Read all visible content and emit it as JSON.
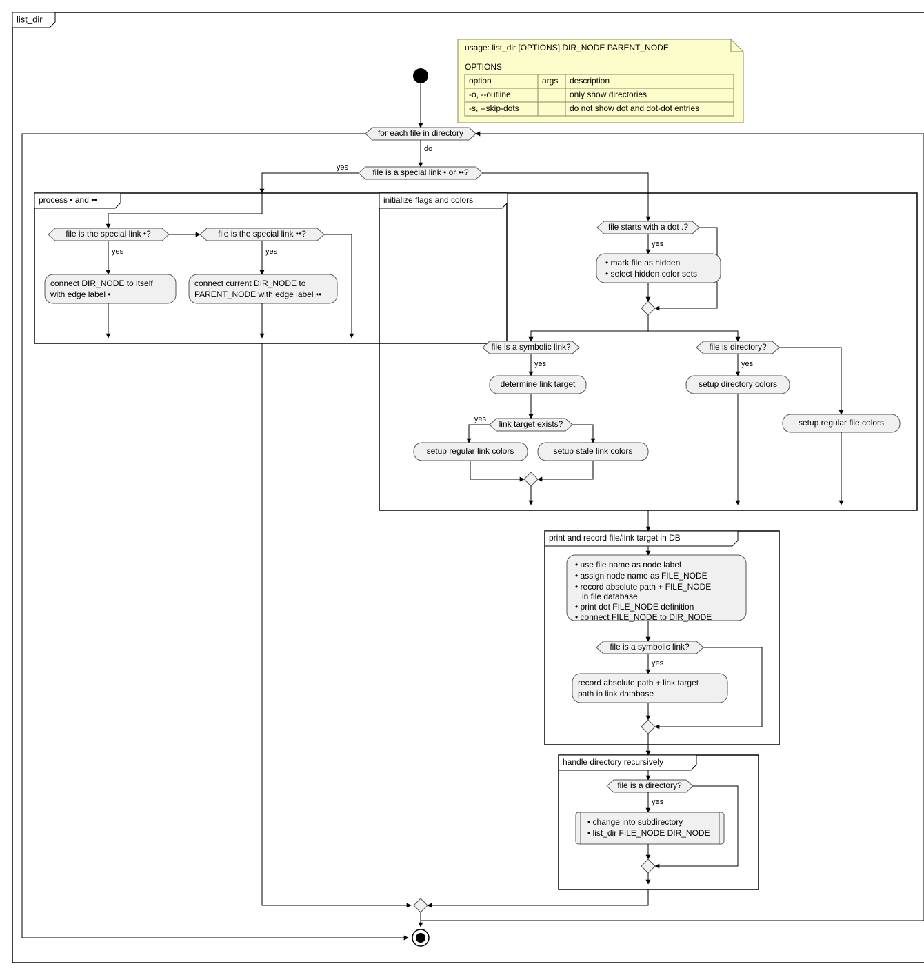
{
  "outer_frame": "list_dir",
  "note": {
    "usage": "usage: list_dir [OPTIONS] DIR_NODE PARENT_NODE",
    "options_heading": "OPTIONS",
    "headers": {
      "option": "option",
      "args": "args",
      "description": "description"
    },
    "rows": [
      {
        "option": "-o, --outline",
        "args": "",
        "description": "only show directories"
      },
      {
        "option": "-s, --skip-dots",
        "args": "",
        "description": "do not show dot and dot-dot entries"
      }
    ]
  },
  "loop": {
    "label": "for each file in directory",
    "do": "do"
  },
  "dec_special": {
    "q": "file is a special link • or ••?",
    "yes": "yes"
  },
  "grp_dots": {
    "title": "process • and ••",
    "dec_dot": "file is the special link •?",
    "dec_dotdot": "file is the special link ••?",
    "yes": "yes",
    "act_dot_l1": "connect DIR_NODE to itself",
    "act_dot_l2": "with edge label •",
    "act_dotdot_l1": "connect current DIR_NODE to",
    "act_dotdot_l2": "PARENT_NODE with edge label ••"
  },
  "grp_init": {
    "title": "initialize flags and colors",
    "dec_dotstart": "file starts with a dot .?",
    "yes": "yes",
    "act_hidden_b1": "mark file as hidden",
    "act_hidden_b2": "select hidden color sets",
    "dec_symlink": "file is a symbolic link?",
    "dec_isdir": "file is directory?",
    "act_target": "determine link target",
    "dec_target_exists": "link target exists?",
    "act_reg_link": "setup regular link colors",
    "act_stale_link": "setup stale link colors",
    "act_dir_colors": "setup directory colors",
    "act_file_colors": "setup regular file colors"
  },
  "grp_print": {
    "title": "print and record file/link target in DB",
    "b1": "use file name as node label",
    "b2": "assign node name as FILE_NODE",
    "b3": "record absolute path + FILE_NODE",
    "b3b": "in file database",
    "b4": "print dot FILE_NODE definition",
    "b5": "connect FILE_NODE to DIR_NODE",
    "dec_symlink2": "file is a symbolic link?",
    "yes": "yes",
    "act_record_l1": "record absolute path + link target",
    "act_record_l2": "path in link database"
  },
  "grp_recurse": {
    "title": "handle directory recursively",
    "dec_isdir2": "file is a directory?",
    "yes": "yes",
    "b1": "change into subdirectory",
    "b2": "list_dir FILE_NODE DIR_NODE"
  },
  "chart_data": {
    "type": "activity-diagram",
    "name": "list_dir",
    "note": {
      "usage": "usage: list_dir [OPTIONS] DIR_NODE PARENT_NODE",
      "options": [
        {
          "option": "-o, --outline",
          "args": "",
          "description": "only show directories"
        },
        {
          "option": "-s, --skip-dots",
          "args": "",
          "description": "do not show dot and dot-dot entries"
        }
      ]
    },
    "flow": {
      "start": "initial",
      "loop": {
        "condition": "for each file in directory",
        "body": {
          "decision": "file is a special link • or ••?",
          "yes": {
            "group": "process • and ••",
            "steps": [
              {
                "decision": "file is the special link •?",
                "yes": "connect DIR_NODE to itself with edge label •",
                "no": {
                  "decision": "file is the special link ••?",
                  "yes": "connect current DIR_NODE to PARENT_NODE with edge label ••"
                }
              }
            ]
          },
          "no": [
            {
              "group": "initialize flags and colors",
              "steps": [
                {
                  "decision": "file starts with a dot .?",
                  "yes": [
                    "mark file as hidden",
                    "select hidden color sets"
                  ]
                },
                {
                  "decision": "file is a symbolic link?",
                  "yes": [
                    "determine link target",
                    {
                      "decision": "link target exists?",
                      "yes": "setup regular link colors",
                      "no": "setup stale link colors"
                    }
                  ],
                  "no": {
                    "decision": "file is directory?",
                    "yes": "setup directory colors",
                    "no": "setup regular file colors"
                  }
                }
              ]
            },
            {
              "group": "print and record file/link target in DB",
              "steps": [
                [
                  "use file name as node label",
                  "assign node name as FILE_NODE",
                  "record absolute path + FILE_NODE in file database",
                  "print dot FILE_NODE definition",
                  "connect FILE_NODE to DIR_NODE"
                ],
                {
                  "decision": "file is a symbolic link?",
                  "yes": "record absolute path + link target path in link database"
                }
              ]
            },
            {
              "group": "handle directory recursively",
              "steps": [
                {
                  "decision": "file is a directory?",
                  "yes": [
                    "change into subdirectory",
                    "list_dir FILE_NODE DIR_NODE"
                  ]
                }
              ]
            }
          ]
        }
      },
      "end": "final"
    }
  }
}
